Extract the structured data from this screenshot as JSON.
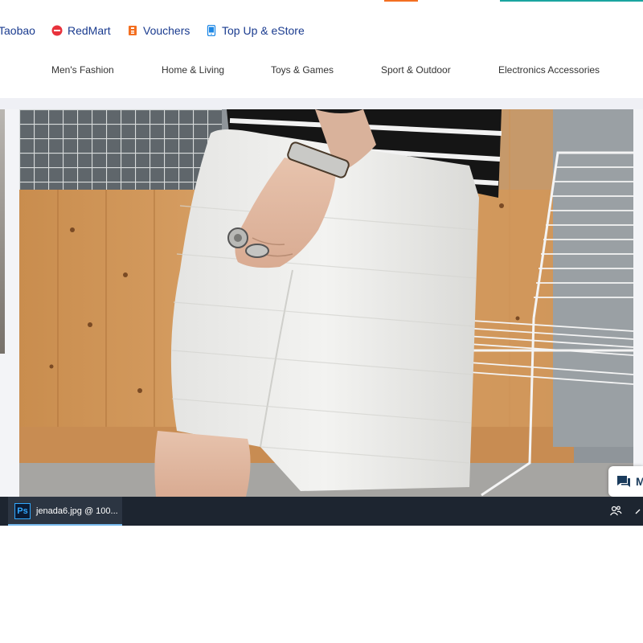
{
  "quicklinks": [
    {
      "label": "Taobao",
      "icon": "taobao-icon"
    },
    {
      "label": "RedMart",
      "icon": "redmart-icon"
    },
    {
      "label": "Vouchers",
      "icon": "voucher-icon"
    },
    {
      "label": "Top Up & eStore",
      "icon": "mobile-topup-icon"
    }
  ],
  "categories": [
    "Men's Fashion",
    "Home & Living",
    "Toys & Games",
    "Sport & Outdoor",
    "Electronics Accessories"
  ],
  "chat": {
    "label": "M",
    "icon": "chat-icon"
  },
  "taskbar": {
    "app_label": "jenada6.jpg @ 100...",
    "app_icon_text": "Ps"
  },
  "colors": {
    "link": "#1a3b8f",
    "redmart": "#e8323c",
    "voucher": "#f36f21",
    "topup": "#1e88e5",
    "photoshop": "#31a8ff",
    "taskbar": "#1d2530"
  }
}
